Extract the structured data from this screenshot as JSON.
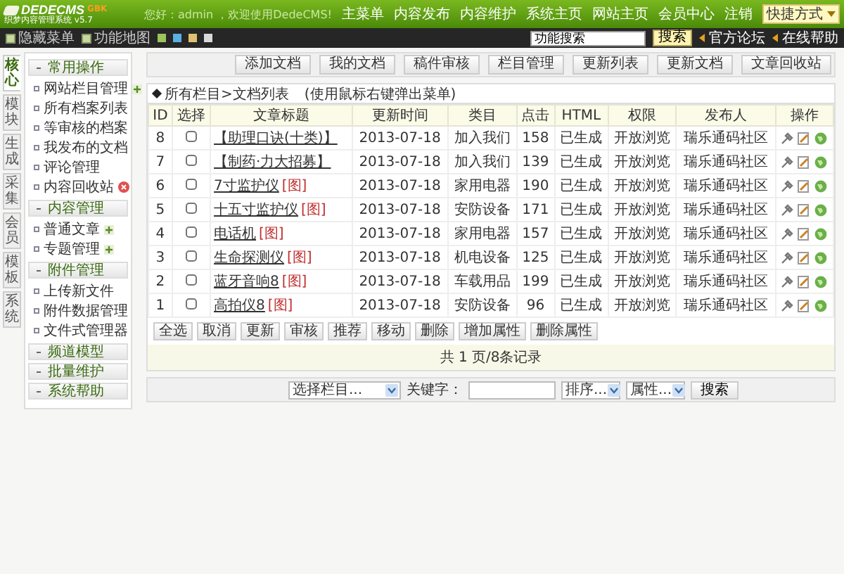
{
  "header": {
    "logo": "DEDECMS",
    "edition": "GBK",
    "subtitle": "织梦内容管理系统 v5.7",
    "greeting": "您好：admin ，欢迎使用DedeCMS!",
    "nav": [
      "主菜单",
      "内容发布",
      "内容维护",
      "系统主页",
      "网站主页",
      "会员中心",
      "注销"
    ],
    "shortcut": "快捷方式"
  },
  "toolbar": {
    "links": [
      "隐藏菜单",
      "功能地图"
    ],
    "swatches": [
      {
        "color": "#9cc45a"
      },
      {
        "color": "#5ab0e0"
      },
      {
        "color": "#e0c070"
      },
      {
        "color": "#d8d8d8"
      }
    ],
    "search": {
      "value": "功能搜索"
    },
    "search_button": "搜索",
    "help_links": [
      "官方论坛",
      "在线帮助"
    ]
  },
  "side_tabs": [
    {
      "label": "核心",
      "selected": true
    },
    {
      "label": "模块",
      "selected": false
    },
    {
      "label": "生成",
      "selected": false
    },
    {
      "label": "采集",
      "selected": false
    },
    {
      "label": "会员",
      "selected": false
    },
    {
      "label": "模板",
      "selected": false
    },
    {
      "label": "系统",
      "selected": false
    }
  ],
  "menu": [
    {
      "title": "常用操作",
      "items": [
        {
          "label": "网站栏目管理",
          "kind": "add"
        },
        {
          "label": "所有档案列表",
          "kind": "plain"
        },
        {
          "label": "等审核的档案",
          "kind": "plain"
        },
        {
          "label": "我发布的文档",
          "kind": "plain"
        },
        {
          "label": "评论管理",
          "kind": "plain"
        },
        {
          "label": "内容回收站",
          "kind": "trash"
        }
      ]
    },
    {
      "title": "内容管理",
      "items": [
        {
          "label": "普通文章",
          "kind": "add"
        },
        {
          "label": "专题管理",
          "kind": "add"
        }
      ]
    },
    {
      "title": "附件管理",
      "items": [
        {
          "label": "上传新文件",
          "kind": "plain"
        },
        {
          "label": "附件数据管理",
          "kind": "plain"
        },
        {
          "label": "文件式管理器",
          "kind": "plain"
        }
      ]
    },
    {
      "title": "频道模型"
    },
    {
      "title": "批量维护"
    },
    {
      "title": "系统帮助"
    }
  ],
  "main": {
    "top_buttons": [
      "添加文档",
      "我的文档",
      "稿件审核",
      "栏目管理",
      "更新列表",
      "更新文档",
      "文章回收站"
    ],
    "breadcrumb": "所有栏目>文档列表",
    "hint": "(使用鼠标右键弹出菜单)",
    "table": {
      "columns": [
        "ID",
        "选择",
        "文章标题",
        "更新时间",
        "类目",
        "点击",
        "HTML",
        "权限",
        "发布人",
        "操作"
      ],
      "rows": [
        {
          "id": "8",
          "checked": false,
          "title": "【助理口诀(十类)】",
          "tag": null,
          "time": "2013-07-18",
          "category": "加入我们",
          "clicks": "158",
          "html": "已生成",
          "access": "开放浏览",
          "author": "瑞乐通码社区"
        },
        {
          "id": "7",
          "checked": false,
          "title": "【制药·力大招募】",
          "tag": null,
          "time": "2013-07-18",
          "category": "加入我们",
          "clicks": "139",
          "html": "已生成",
          "access": "开放浏览",
          "author": "瑞乐通码社区"
        },
        {
          "id": "6",
          "checked": false,
          "title": "7寸监护仪",
          "tag": "[图]",
          "time": "2013-07-18",
          "category": "家用电器",
          "clicks": "190",
          "html": "已生成",
          "access": "开放浏览",
          "author": "瑞乐通码社区"
        },
        {
          "id": "5",
          "checked": false,
          "title": "十五寸监护仪",
          "tag": "[图]",
          "time": "2013-07-18",
          "category": "安防设备",
          "clicks": "171",
          "html": "已生成",
          "access": "开放浏览",
          "author": "瑞乐通码社区"
        },
        {
          "id": "4",
          "checked": false,
          "title": "电话机",
          "tag": "[图]",
          "time": "2013-07-18",
          "category": "家用电器",
          "clicks": "157",
          "html": "已生成",
          "access": "开放浏览",
          "author": "瑞乐通码社区"
        },
        {
          "id": "3",
          "checked": false,
          "title": "生命探测仪",
          "tag": "[图]",
          "time": "2013-07-18",
          "category": "机电设备",
          "clicks": "125",
          "html": "已生成",
          "access": "开放浏览",
          "author": "瑞乐通码社区"
        },
        {
          "id": "2",
          "checked": false,
          "title": "蓝牙音响8",
          "tag": "[图]",
          "time": "2013-07-18",
          "category": "车载用品",
          "clicks": "199",
          "html": "已生成",
          "access": "开放浏览",
          "author": "瑞乐通码社区"
        },
        {
          "id": "1",
          "checked": false,
          "title": "高拍仪8",
          "tag": "[图]",
          "time": "2013-07-18",
          "category": "安防设备",
          "clicks": "96",
          "html": "已生成",
          "access": "开放浏览",
          "author": "瑞乐通码社区"
        }
      ]
    },
    "bulk_buttons": [
      "全选",
      "取消",
      "更新",
      "审核",
      "推荐",
      "移动",
      "删除",
      "增加属性",
      "删除属性"
    ],
    "pager": "共 1 页/8条记录",
    "filter": {
      "column_select": "选择栏目...",
      "keyword_label": "关键字：",
      "order_select": "排序...",
      "attr_select": "属性...",
      "search_button": "搜索"
    }
  }
}
